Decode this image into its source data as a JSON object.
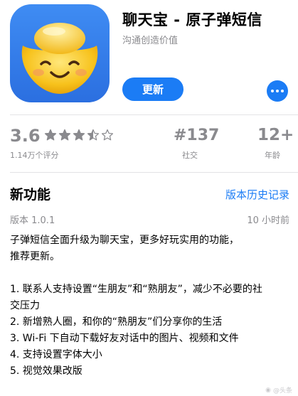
{
  "app": {
    "title": "聊天宝 - 原子弹短信",
    "subtitle": "沟通创造价值",
    "update_label": "更新",
    "icon": "smiling-gold-ingot-icon",
    "accent": "#1b7cf5"
  },
  "stats": {
    "rating_value": "3.6",
    "rating_stars": 3.5,
    "rating_count": "1.14万个评分",
    "rank_value": "#137",
    "rank_label": "社交",
    "age_value": "12+",
    "age_label": "年龄"
  },
  "whats_new": {
    "title": "新功能",
    "history_link": "版本历史记录",
    "version": "版本 1.0.1",
    "updated": "10 小时前",
    "intro": [
      "子弹短信全面升级为聊天宝，更多好玩实用的功能，",
      "推荐更新。"
    ],
    "items": [
      "1. 联系人支持设置“生朋友”和“熟朋友”，减少不必要的社",
      "交压力",
      "2. 新增熟人圈，和你的“熟朋友”们分享你的生活",
      "3. Wi-Fi 下自动下载好友对话中的图片、视频和文件",
      "4. 支持设置字体大小",
      "5. 视觉效果改版"
    ]
  },
  "watermark": "@头条"
}
